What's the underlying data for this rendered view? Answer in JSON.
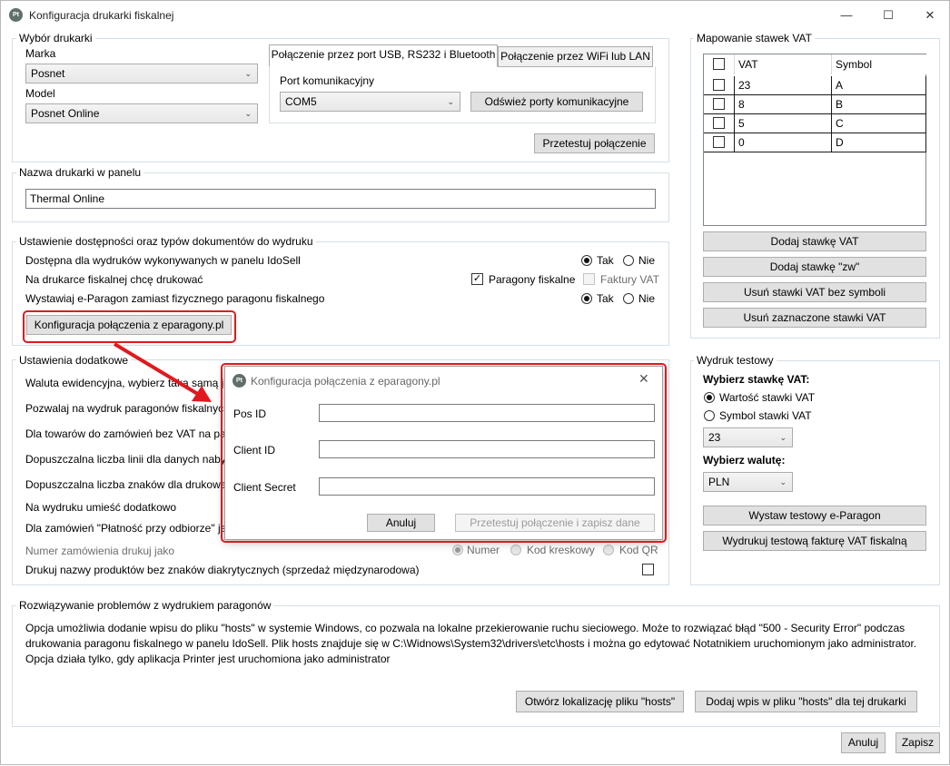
{
  "window": {
    "title": "Konfiguracja drukarki fiskalnej",
    "icon_text": "Pt",
    "controls": {
      "minimize": "—",
      "maximize": "☐",
      "close": "✕"
    }
  },
  "printer_select": {
    "group_title": "Wybór drukarki",
    "brand_label": "Marka",
    "brand_value": "Posnet",
    "model_label": "Model",
    "model_value": "Posnet Online",
    "tabs": [
      {
        "label": "Połączenie przez port USB, RS232 i Bluetooth",
        "active": true
      },
      {
        "label": "Połączenie przez WiFi lub LAN",
        "active": false
      }
    ],
    "port_label": "Port komunikacyjny",
    "port_value": "COM5",
    "refresh_button": "Odśwież porty komunikacyjne",
    "test_button": "Przetestuj połączenie"
  },
  "printer_name": {
    "group_title": "Nazwa drukarki w panelu",
    "value": "Thermal Online"
  },
  "availability": {
    "group_title": "Ustawienie dostępności oraz typów dokumentów do wydruku",
    "row1_label": "Dostępna dla wydruków wykonywanych w panelu IdoSell",
    "row2_label": "Na drukarce fiskalnej chcę drukować",
    "row3_label": "Wystawiaj e-Paragon zamiast fizycznego paragonu fiskalnego",
    "yes": "Tak",
    "no": "Nie",
    "receipts": "Paragony fiskalne",
    "invoices": "Faktury VAT",
    "eparagony_button": "Konfiguracja połączenia z eparagony.pl"
  },
  "additional": {
    "group_title": "Ustawienia dodatkowe",
    "rows": [
      "Waluta ewidencyjna, wybierz taką samą ja",
      "Pozwalaj na wydruk paragonów fiskalnyc",
      "Dla towarów do zamówień bez VAT na pa",
      "Dopuszczalna liczba linii dla danych naby",
      "Dopuszczalna liczba znaków dla drukowa",
      "Na wydruku umieść dodatkowo",
      "Dla zamówień \"Płatność przy odbiorze\" ja"
    ],
    "order_number_label": "Numer zamówienia drukuj jako",
    "order_number_options": [
      "Numer",
      "Kod kreskowy",
      "Kod QR"
    ],
    "no_diacritics_label": "Drukuj nazwy produktów bez znaków diakrytycznych (sprzedaż międzynarodowa)"
  },
  "vat_mapping": {
    "group_title": "Mapowanie stawek VAT",
    "headers": [
      "VAT",
      "Symbol"
    ],
    "rows": [
      {
        "vat": "23",
        "symbol": "A"
      },
      {
        "vat": "8",
        "symbol": "B"
      },
      {
        "vat": "5",
        "symbol": "C"
      },
      {
        "vat": "0",
        "symbol": "D"
      }
    ],
    "buttons": [
      "Dodaj stawkę VAT",
      "Dodaj stawkę \"zw\"",
      "Usuń stawki VAT bez symboli",
      "Usuń zaznaczone stawki VAT"
    ]
  },
  "test_print": {
    "group_title": "Wydruk testowy",
    "vat_heading": "Wybierz stawkę VAT:",
    "vat_value_option": "Wartość stawki VAT",
    "vat_symbol_option": "Symbol stawki VAT",
    "vat_select": "23",
    "currency_heading": "Wybierz walutę:",
    "currency_select": "PLN",
    "eparagon_button": "Wystaw testowy e-Paragon",
    "invoice_button": "Wydrukuj testową fakturę VAT fiskalną"
  },
  "troubleshoot": {
    "group_title": "Rozwiązywanie problemów z wydrukiem paragonów",
    "line1": "Opcja umożliwia dodanie wpisu do pliku \"hosts\" w systemie Windows, co pozwala na lokalne przekierowanie ruchu sieciowego. Może to rozwiązać błąd \"500 - Security Error\" podczas",
    "line2": "drukowania paragonu fiskalnego w panelu IdoSell. Plik hosts znajduje się w C:\\Widnows\\System32\\drivers\\etc\\hosts i można go edytować Notatnikiem uruchomionym jako administrator.",
    "line3": "Opcja działa tylko, gdy aplikacja Printer jest uruchomiona jako administrator",
    "open_button": "Otwórz lokalizację pliku \"hosts\"",
    "add_button": "Dodaj wpis w pliku \"hosts\" dla tej drukarki"
  },
  "footer": {
    "cancel": "Anuluj",
    "save": "Zapisz"
  },
  "dialog": {
    "title": "Konfiguracja połączenia z eparagony.pl",
    "pos_id_label": "Pos ID",
    "client_id_label": "Client ID",
    "client_secret_label": "Client Secret",
    "pos_id_value": "",
    "client_id_value": "",
    "client_secret_value": "",
    "cancel": "Anuluj",
    "save": "Przetestuj połączenie i zapisz dane",
    "close": "✕"
  },
  "colors": {
    "highlight": "#e0191e",
    "group_border": "#d5dfe5",
    "button_bg": "#e1e1e1"
  }
}
